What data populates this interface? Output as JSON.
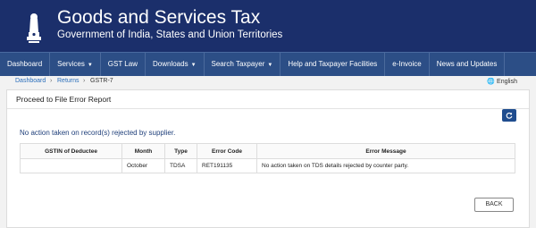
{
  "header": {
    "title": "Goods and Services Tax",
    "subtitle": "Government of India, States and Union Territories",
    "emblem_icon": "national-emblem-icon"
  },
  "nav": {
    "items": [
      {
        "label": "Dashboard",
        "dropdown": false
      },
      {
        "label": "Services",
        "dropdown": true
      },
      {
        "label": "GST Law",
        "dropdown": false
      },
      {
        "label": "Downloads",
        "dropdown": true
      },
      {
        "label": "Search Taxpayer",
        "dropdown": true
      },
      {
        "label": "Help and Taxpayer Facilities",
        "dropdown": false
      },
      {
        "label": "e-Invoice",
        "dropdown": false
      },
      {
        "label": "News and Updates",
        "dropdown": false
      }
    ]
  },
  "breadcrumb": {
    "items": [
      "Dashboard",
      "Returns",
      "GSTR-7"
    ],
    "separator": "›"
  },
  "language": "English",
  "panel": {
    "title": "Proceed to File Error Report",
    "notice": "No action taken on record(s) rejected by supplier."
  },
  "table": {
    "headers": [
      "GSTIN of Deductee",
      "Month",
      "Type",
      "Error Code",
      "Error Message"
    ],
    "rows": [
      [
        "",
        "October",
        "TDSA",
        "RET191135",
        "No action taken on TDS details rejected by counter party."
      ]
    ]
  },
  "back_label": "BACK",
  "colors": {
    "header_bg": "#1b2f6b",
    "nav_bg": "#2c4e86",
    "link": "#2a6ebb",
    "notice_text": "#1f3f7a",
    "refresh_button": "#1f4d8f"
  }
}
